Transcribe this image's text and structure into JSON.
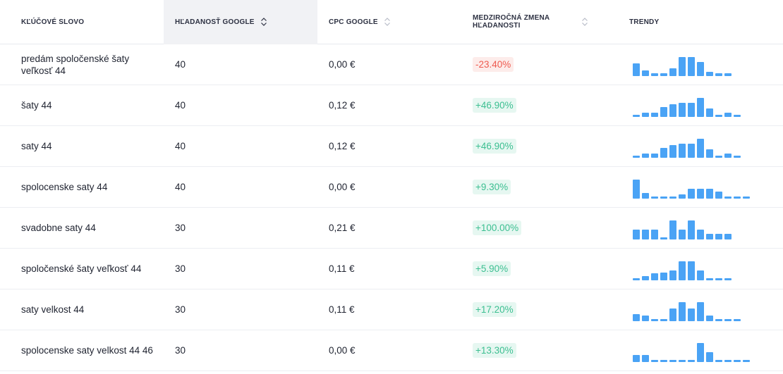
{
  "headers": {
    "keyword": "KĽÚČOVÉ SLOVO",
    "volume": "HĽADANOSŤ GOOGLE",
    "cpc": "CPC GOOGLE",
    "yoy": "MEDZIROČNÁ ZMENA HĽADANOSTI",
    "trends": "TRENDY"
  },
  "colors": {
    "bar": "#4aa3f5",
    "negative": "#ee5a4f",
    "positive": "#3cbf91"
  },
  "rows": [
    {
      "keyword": "predám spoločenské šaty veľkosť 44",
      "volume": "40",
      "cpc": "0,00 €",
      "yoy": "-23.40%",
      "trend": "neg",
      "bars": [
        0.55,
        0.25,
        0.12,
        0.12,
        0.35,
        0.85,
        0.85,
        0.62,
        0.2,
        0.12,
        0.12
      ]
    },
    {
      "keyword": "šaty 44",
      "volume": "40",
      "cpc": "0,12 €",
      "yoy": "+46.90%",
      "trend": "pos",
      "bars": [
        0.08,
        0.2,
        0.2,
        0.45,
        0.55,
        0.62,
        0.62,
        0.85,
        0.38,
        0.1,
        0.2,
        0.1
      ]
    },
    {
      "keyword": "saty 44",
      "volume": "40",
      "cpc": "0,12 €",
      "yoy": "+46.90%",
      "trend": "pos",
      "bars": [
        0.08,
        0.2,
        0.2,
        0.45,
        0.55,
        0.62,
        0.62,
        0.85,
        0.38,
        0.1,
        0.2,
        0.1
      ]
    },
    {
      "keyword": "spolocenske saty 44",
      "volume": "40",
      "cpc": "0,00 €",
      "yoy": "+9.30%",
      "trend": "pos",
      "bars": [
        0.85,
        0.25,
        0.08,
        0.08,
        0.08,
        0.2,
        0.45,
        0.45,
        0.45,
        0.3,
        0.08,
        0.08,
        0.08
      ]
    },
    {
      "keyword": "svadobne saty 44",
      "volume": "30",
      "cpc": "0,21 €",
      "yoy": "+100.00%",
      "trend": "pos",
      "bars": [
        0.45,
        0.45,
        0.45,
        0.08,
        0.85,
        0.45,
        0.85,
        0.45,
        0.25,
        0.25,
        0.25
      ]
    },
    {
      "keyword": "spoločenské šaty veľkosť 44",
      "volume": "30",
      "cpc": "0,11 €",
      "yoy": "+5.90%",
      "trend": "pos",
      "bars": [
        0.08,
        0.2,
        0.3,
        0.35,
        0.45,
        0.85,
        0.85,
        0.45,
        0.08,
        0.08,
        0.08
      ]
    },
    {
      "keyword": "saty velkost 44",
      "volume": "30",
      "cpc": "0,11 €",
      "yoy": "+17.20%",
      "trend": "pos",
      "bars": [
        0.3,
        0.25,
        0.08,
        0.08,
        0.55,
        0.85,
        0.55,
        0.85,
        0.25,
        0.08,
        0.08,
        0.08
      ]
    },
    {
      "keyword": "spolocenske saty velkost 44 46",
      "volume": "30",
      "cpc": "0,00 €",
      "yoy": "+13.30%",
      "trend": "pos",
      "bars": [
        0.3,
        0.3,
        0.08,
        0.08,
        0.08,
        0.08,
        0.08,
        0.85,
        0.45,
        0.08,
        0.08,
        0.08,
        0.08
      ]
    }
  ]
}
